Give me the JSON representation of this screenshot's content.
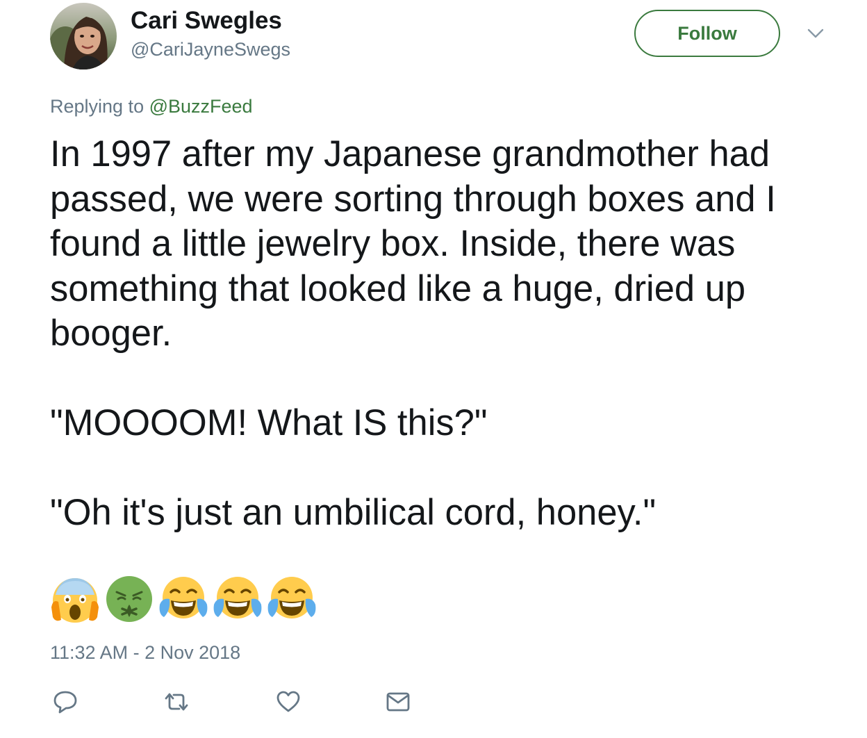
{
  "author": {
    "display_name": "Cari Swegles",
    "handle": "@CariJayneSwegs"
  },
  "header": {
    "follow_label": "Follow",
    "more_icon": "chevron-down-icon"
  },
  "reply": {
    "prefix": "Replying to ",
    "mention": "@BuzzFeed"
  },
  "tweet": {
    "paragraphs": [
      "In 1997 after my Japanese grandmother had passed, we were sorting through boxes and I found a little jewelry box. Inside, there was something that looked like a huge, dried up booger.",
      "\"MOOOOM! What IS this?\"",
      "\"Oh it's just an umbilical cord, honey.\""
    ],
    "emojis": [
      "face-screaming-in-fear",
      "nauseated-face",
      "face-with-tears-of-joy",
      "face-with-tears-of-joy",
      "face-with-tears-of-joy"
    ],
    "timestamp": "11:32 AM - 2 Nov 2018"
  },
  "actions": [
    {
      "name": "reply",
      "icon": "reply-icon"
    },
    {
      "name": "retweet",
      "icon": "retweet-icon"
    },
    {
      "name": "like",
      "icon": "heart-icon"
    },
    {
      "name": "direct-message",
      "icon": "envelope-icon"
    }
  ],
  "colors": {
    "accent_green": "#3a7a3e",
    "secondary_text": "#657786",
    "primary_text": "#14171a"
  }
}
